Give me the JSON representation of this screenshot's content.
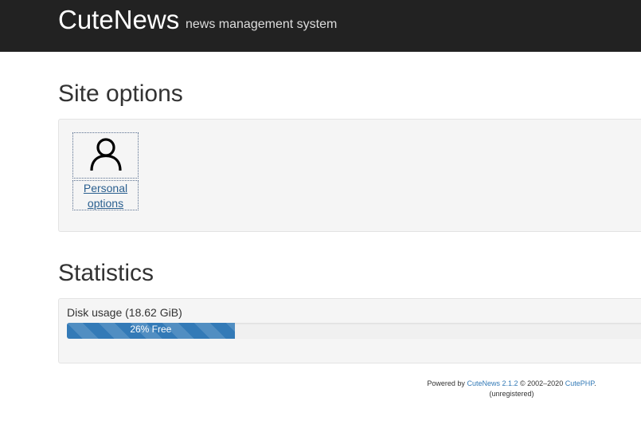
{
  "header": {
    "brand": "CuteNews",
    "subtitle": "news management system"
  },
  "site_options": {
    "title": "Site options",
    "items": [
      {
        "icon": "user-icon",
        "label_line1": "Personal",
        "label_line2": "options"
      }
    ]
  },
  "statistics": {
    "title": "Statistics",
    "disk_usage_label": "Disk usage (18.62 GiB)",
    "progress_text": "26% Free",
    "free_percent": 26,
    "bar_color": "#337ab7"
  },
  "footer": {
    "powered_by": "Powered by",
    "cutenews_link": "CuteNews 2.1.2",
    "copyright": "© 2002–2020",
    "cutephp_link": "CutePHP",
    "period": ".",
    "registration": "(unregistered)"
  },
  "colors": {
    "navbar": "#222222",
    "link": "#337ab7",
    "panel": "#f5f5f5"
  }
}
